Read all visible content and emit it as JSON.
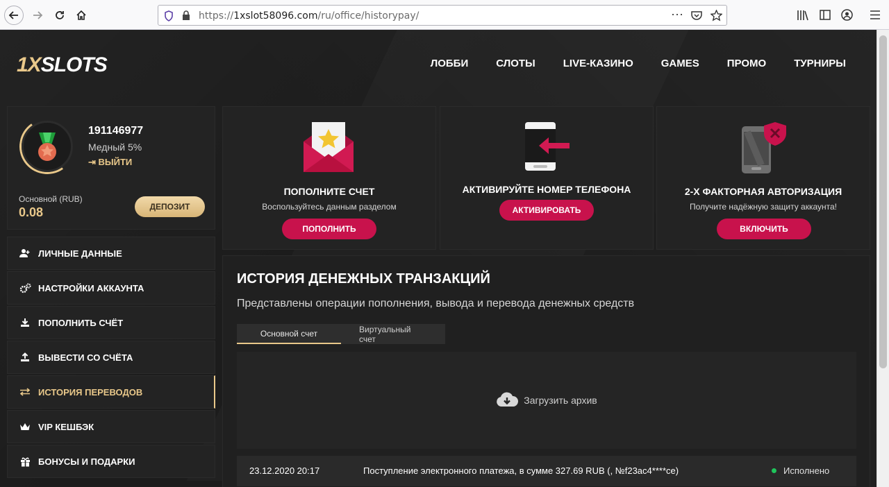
{
  "browser": {
    "url_prefix": "https://",
    "url_host": "1xslot58096.com",
    "url_path": "/ru/office/historypay/"
  },
  "header": {
    "logo_a": "1X",
    "logo_b": "SLOTS",
    "nav": [
      "ЛОББИ",
      "СЛОТЫ",
      "LIVE-КАЗИНО",
      "GAMES",
      "ПРОМО",
      "ТУРНИРЫ"
    ]
  },
  "profile": {
    "user_id": "191146977",
    "level": "Медный 5%",
    "logout": "ВЫЙТИ",
    "balance_label": "Основной (RUB)",
    "balance_value": "0.08",
    "deposit": "ДЕПОЗИТ"
  },
  "menu": [
    {
      "label": "ЛИЧНЫЕ ДАННЫЕ",
      "icon": "user-plus-icon"
    },
    {
      "label": "НАСТРОЙКИ АККАУНТА",
      "icon": "gears-icon"
    },
    {
      "label": "ПОПОЛНИТЬ СЧЁТ",
      "icon": "download-icon"
    },
    {
      "label": "ВЫВЕСТИ СО СЧЁТА",
      "icon": "upload-icon"
    },
    {
      "label": "ИСТОРИЯ ПЕРЕВОДОВ",
      "icon": "transfer-arrows-icon",
      "active": true
    },
    {
      "label": "VIP КЕШБЭК",
      "icon": "crown-icon"
    },
    {
      "label": "БОНУСЫ И ПОДАРКИ",
      "icon": "gift-icon"
    }
  ],
  "promos": {
    "deposit": {
      "title": "ПОПОЛНИТЕ СЧЕТ",
      "subtitle": "Воспользуйтесь данным разделом",
      "button": "ПОПОЛНИТЬ"
    },
    "phone": {
      "title": "АКТИВИРУЙТЕ НОМЕР ТЕЛЕФОНА",
      "button": "АКТИВИРОВАТЬ"
    },
    "twofa": {
      "title": "2-Х ФАКТОРНАЯ АВТОРИЗАЦИЯ",
      "subtitle": "Получите надёжную защиту аккаунта!",
      "button": "ВКЛЮЧИТЬ"
    }
  },
  "history": {
    "title": "ИСТОРИЯ ДЕНЕЖНЫХ ТРАНЗАКЦИЙ",
    "subtitle": "Представлены операции пополнения, вывода и перевода денежных средств",
    "tabs": [
      "Основной счет",
      "Виртуальный счет"
    ],
    "archive": "Загрузить архив",
    "rows": [
      {
        "date": "23.12.2020 20:17",
        "description": "Поступление электронного платежа, в сумме 327.69 RUB (, №f23ac4****ce)",
        "status": "Исполнено"
      }
    ]
  },
  "colors": {
    "accent": "#e9c88a",
    "pink": "#c8124c",
    "status_ok": "#1fc55b"
  }
}
